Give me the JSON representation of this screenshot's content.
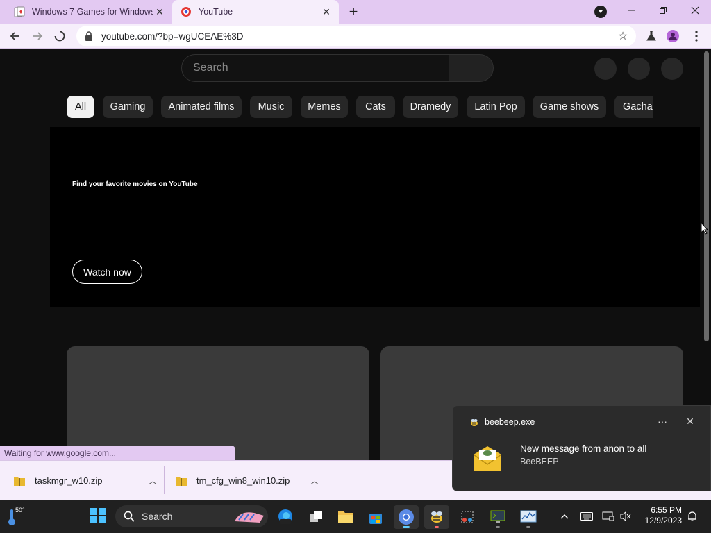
{
  "browser": {
    "tabs": [
      {
        "title": "Windows 7 Games for Windows",
        "active": false
      },
      {
        "title": "YouTube",
        "active": true
      }
    ],
    "url": "youtube.com/?bp=wgUCEAE%3D",
    "status_text": "Waiting for www.google.com..."
  },
  "youtube": {
    "search_placeholder": "Search",
    "chips": [
      "All",
      "Gaming",
      "Animated films",
      "Music",
      "Memes",
      "Cats",
      "Dramedy",
      "Latin Pop",
      "Game shows",
      "Gacha"
    ],
    "selected_chip": "All",
    "banner": {
      "headline": "Find your favorite movies on YouTube",
      "button_label": "Watch now"
    }
  },
  "downloads": [
    {
      "filename": "taskmgr_w10.zip"
    },
    {
      "filename": "tm_cfg_win8_win10.zip"
    }
  ],
  "notification": {
    "app_name": "beebeep.exe",
    "message": "New message from anon to all",
    "sub": "BeeBEEP"
  },
  "taskbar": {
    "temperature": "50°",
    "search_label": "Search",
    "time": "6:55 PM",
    "date": "12/9/2023"
  },
  "colors": {
    "browser_frame": "#e3c9f2",
    "youtube_bg": "#0f0f0f",
    "accent": "#60cdff"
  }
}
